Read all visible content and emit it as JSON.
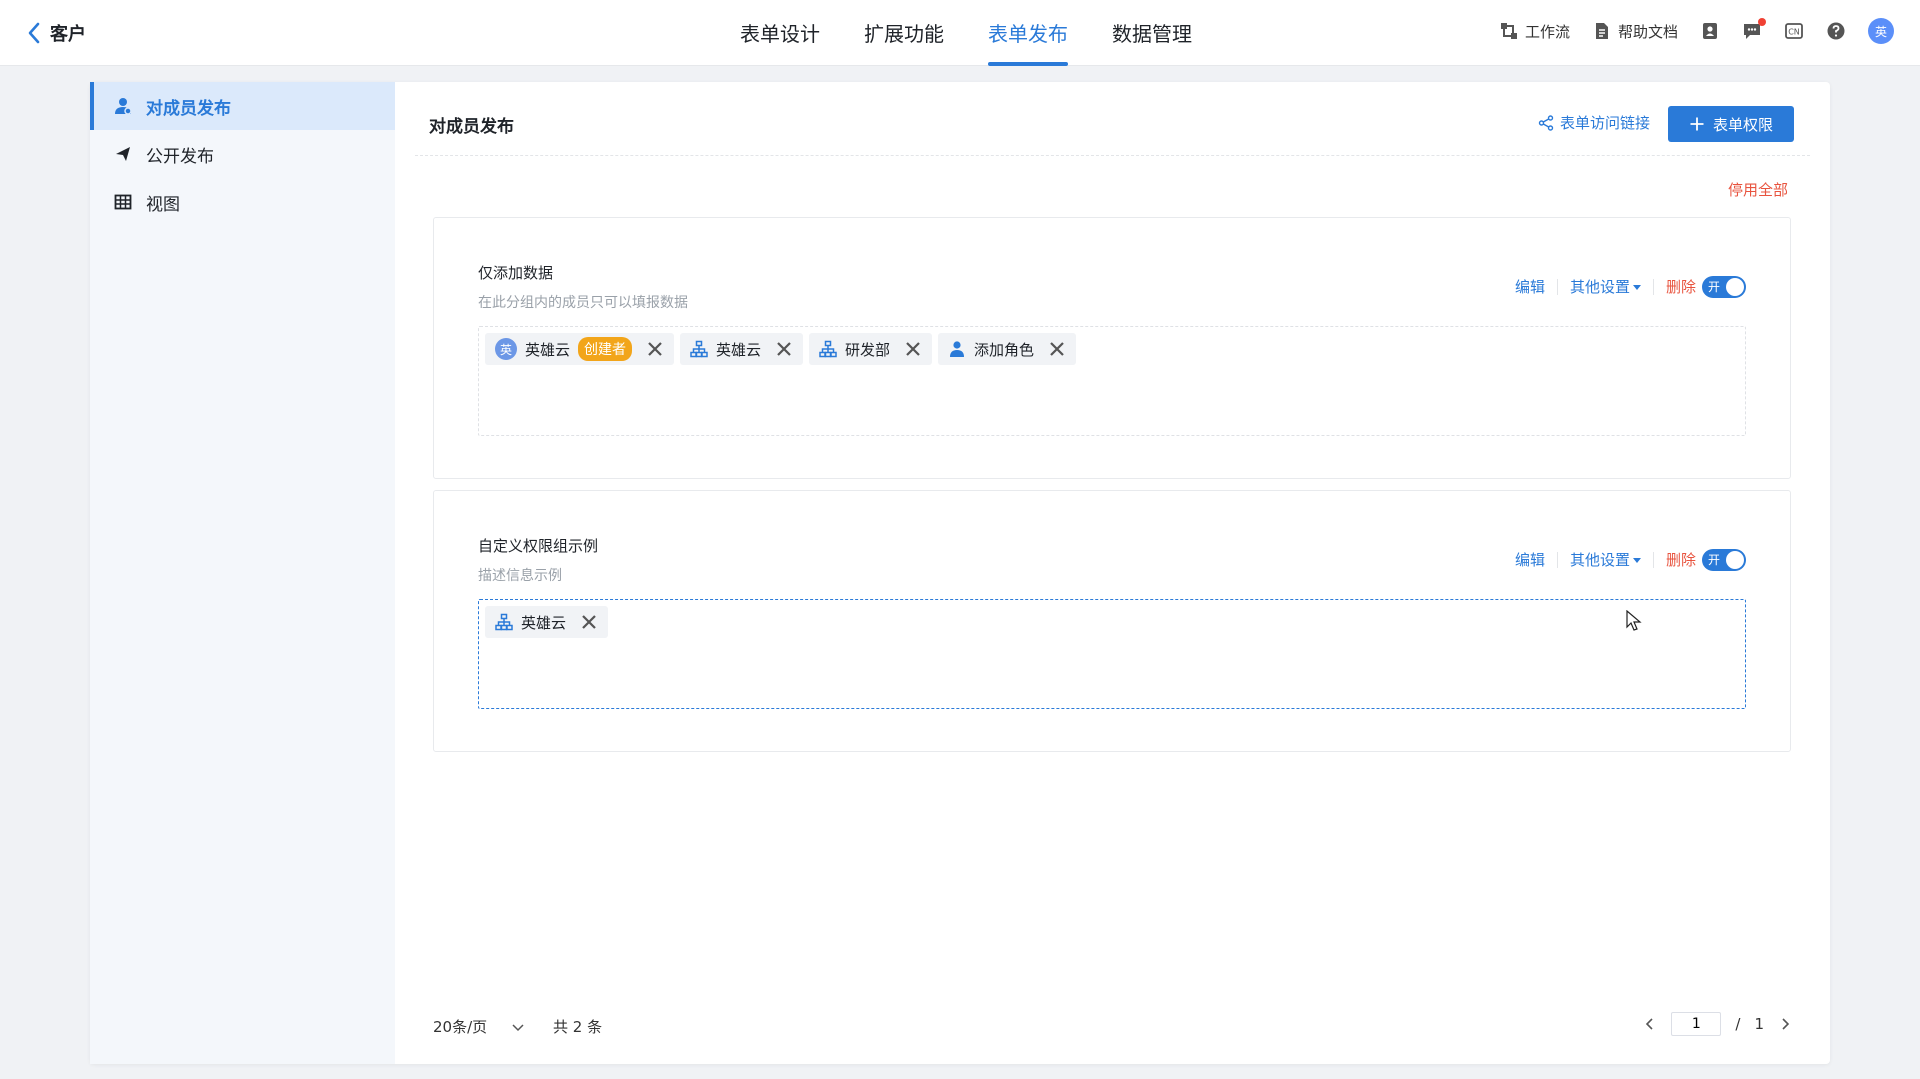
{
  "topbar": {
    "back_label": "客户",
    "tabs": [
      {
        "label": "表单设计"
      },
      {
        "label": "扩展功能"
      },
      {
        "label": "表单发布"
      },
      {
        "label": "数据管理"
      }
    ],
    "active_tab": 2,
    "tools": {
      "workflow": "工作流",
      "help_docs": "帮助文档",
      "lang": "CN",
      "avatar": "英"
    }
  },
  "sidebar": {
    "items": [
      {
        "label": "对成员发布",
        "icon": "user-icon"
      },
      {
        "label": "公开发布",
        "icon": "send-icon"
      },
      {
        "label": "视图",
        "icon": "table-icon"
      }
    ]
  },
  "main": {
    "title": "对成员发布",
    "access_link": "表单访问链接",
    "permission_button": "表单权限",
    "disable_all": "停用全部",
    "actions": {
      "edit": "编辑",
      "other": "其他设置",
      "delete": "删除",
      "switch_on": "开"
    },
    "groups": [
      {
        "name": "仅添加数据",
        "desc": "在此分组内的成员只可以填报数据",
        "members": [
          {
            "type": "user",
            "avatar": "英",
            "label": "英雄云",
            "badge": "创建者"
          },
          {
            "type": "org",
            "label": "英雄云"
          },
          {
            "type": "org",
            "label": "研发部"
          },
          {
            "type": "role",
            "label": "添加角色"
          }
        ]
      },
      {
        "name": "自定义权限组示例",
        "desc": "描述信息示例",
        "members": [
          {
            "type": "org",
            "label": "英雄云"
          }
        ]
      }
    ]
  },
  "pager": {
    "page_size": "20条/页",
    "total": "共 2 条",
    "current": "1",
    "separator": "/",
    "pages": "1"
  },
  "colors": {
    "accent": "#2a7ad8",
    "danger": "#e8543f",
    "badge": "#f2a51a"
  }
}
